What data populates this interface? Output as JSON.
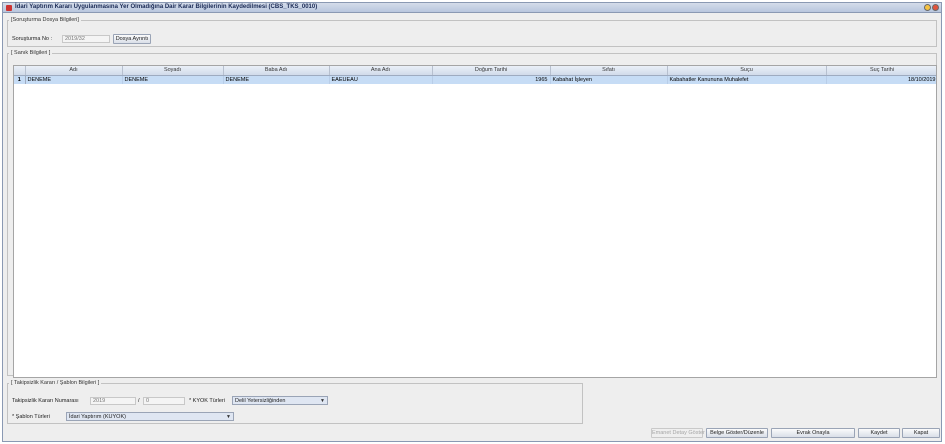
{
  "window": {
    "title": "İdari Yaptırım Kararı Uygulanmasına Yer Olmadığına Dair Karar Bilgilerinin Kaydedilmesi (CBS_TKS_0010)"
  },
  "dosya": {
    "legend": "[Soruşturma Dosya Bilgileri]",
    "no_label": "Soruşturma No :",
    "no_value": "2019/32",
    "ayrinti_button": "Dosya Ayrıntı"
  },
  "sanik": {
    "legend": "[ Sanık Bilgileri ]",
    "columns": [
      "Adı",
      "Soyadı",
      "Baba Adı",
      "Ana Adı",
      "Doğum Tarihi",
      "Sıfatı",
      "Suçu",
      "Suç Tarihi"
    ],
    "rows": [
      {
        "num": "1",
        "cells": [
          "DENEME",
          "DENEME",
          "DENEME",
          "EAEUEAU",
          "1965",
          "Kabahat İşleyen",
          "Kabahatler Kanununa Muhalefet",
          "18/10/2019"
        ]
      }
    ]
  },
  "karar": {
    "legend": "[ Takipsizlik Kararı / Şablon Bilgileri ]",
    "numara_label": "Takipsizlik Kararı Numarası",
    "numara_yil": "2019",
    "slash": "/",
    "numara_sira": "0",
    "kyok_label": "* KYOK Türleri",
    "kyok_value": "Delil Yetersizliğinden",
    "sablon_label": "* Şablon Türleri",
    "sablon_value": "İdari Yaptırım (KUYOK)"
  },
  "footer": {
    "emanet_button": "Emanet Detay Göster",
    "belge_button": "Belge Göster/Düzenle",
    "evrak_button": "Evrak Onayla",
    "kaydet_button": "Kaydet",
    "kapat_button": "Kapat"
  }
}
